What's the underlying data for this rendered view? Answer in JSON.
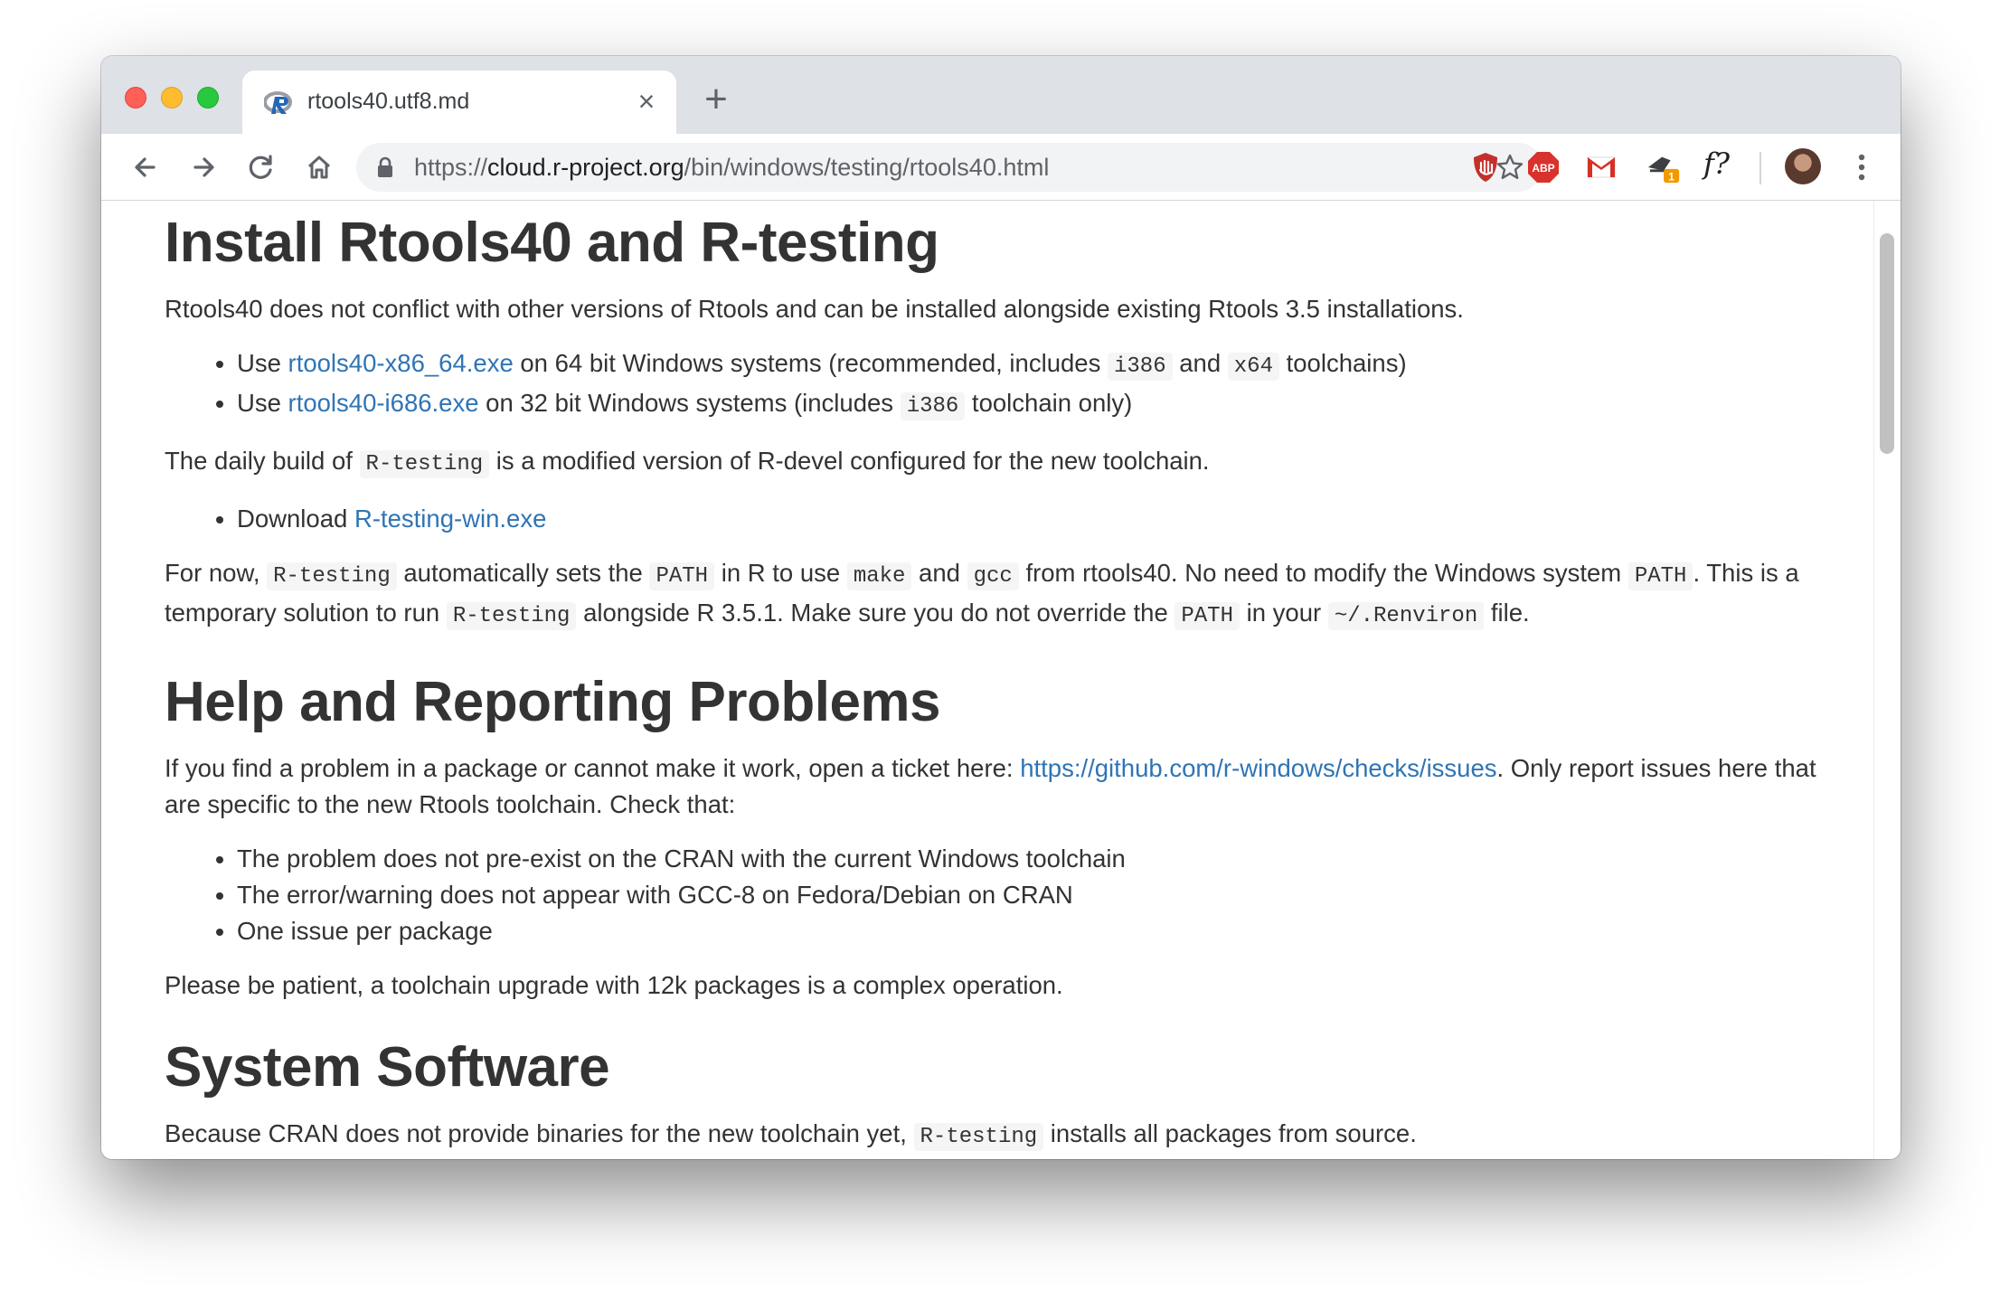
{
  "tab": {
    "title": "rtools40.utf8.md",
    "close_glyph": "×",
    "new_tab_glyph": "+"
  },
  "address_bar": {
    "scheme": "https://",
    "host": "cloud.r-project.org",
    "path": "/bin/windows/testing/rtools40.html"
  },
  "icons": {
    "back": "back-arrow-icon",
    "forward": "forward-arrow-icon",
    "reload": "reload-icon",
    "home": "home-icon",
    "lock": "lock-icon",
    "bookmark": "star-icon",
    "ext1": "ublock-icon",
    "ext2": "adblock-plus-icon",
    "ext3": "gmail-icon",
    "ext4": "stamp-extension-icon",
    "ext5": "formula-icon",
    "menu": "kebab-menu-icon"
  },
  "extensions": {
    "abp_label": "ABP",
    "badge_count": "1",
    "formula_label": "f?"
  },
  "article": {
    "section1": {
      "heading": "Install Rtools40 and R-testing",
      "intro": "Rtools40 does not conflict with other versions of Rtools and can be installed alongside existing Rtools 3.5 installations.",
      "bullet1": {
        "prefix": "Use ",
        "link": "rtools40-x86_64.exe",
        "mid1": " on 64 bit Windows systems (recommended, includes ",
        "code1": "i386",
        "mid2": " and ",
        "code2": "x64",
        "suffix": " toolchains)"
      },
      "bullet2": {
        "prefix": "Use ",
        "link": "rtools40-i686.exe",
        "mid1": " on 32 bit Windows systems (includes ",
        "code1": "i386",
        "suffix": " toolchain only)"
      },
      "daily": {
        "prefix": "The daily build of ",
        "code": "R-testing",
        "suffix": " is a modified version of R-devel configured for the new toolchain."
      },
      "download": {
        "prefix": "Download ",
        "link": "R-testing-win.exe"
      },
      "fornow": {
        "t1": "For now, ",
        "c1": "R-testing",
        "t2": " automatically sets the ",
        "c2": "PATH",
        "t3": " in R to use ",
        "c3": "make",
        "t4": " and ",
        "c4": "gcc",
        "t5": " from rtools40. No need to modify the Windows system ",
        "c5": "PATH",
        "t6": ". This is a temporary solution to run ",
        "c6": "R-testing",
        "t7": " alongside R 3.5.1. Make sure you do not override the ",
        "c7": "PATH",
        "t8": " in your ",
        "c8": "~/.Renviron",
        "t9": " file."
      }
    },
    "section2": {
      "heading": "Help and Reporting Problems",
      "intro_prefix": "If you find a problem in a package or cannot make it work, open a ticket here: ",
      "intro_link": "https://github.com/r-windows/checks/issues",
      "intro_suffix": ". Only report issues here that are specific to the new Rtools toolchain. Check that:",
      "checks": [
        "The problem does not pre-exist on the CRAN with the current Windows toolchain",
        "The error/warning does not appear with GCC-8 on Fedora/Debian on CRAN",
        "One issue per package"
      ],
      "patience": "Please be patient, a toolchain upgrade with 12k packages is a complex operation."
    },
    "section3": {
      "heading": "System Software",
      "intro_prefix": "Because CRAN does not provide binaries for the new toolchain yet, ",
      "intro_code": "R-testing",
      "intro_suffix": " installs all packages from source."
    }
  },
  "colors": {
    "link": "#2f74b5",
    "text": "#333333",
    "titlebar": "#dee1e6",
    "omnibox": "#f1f3f4"
  }
}
